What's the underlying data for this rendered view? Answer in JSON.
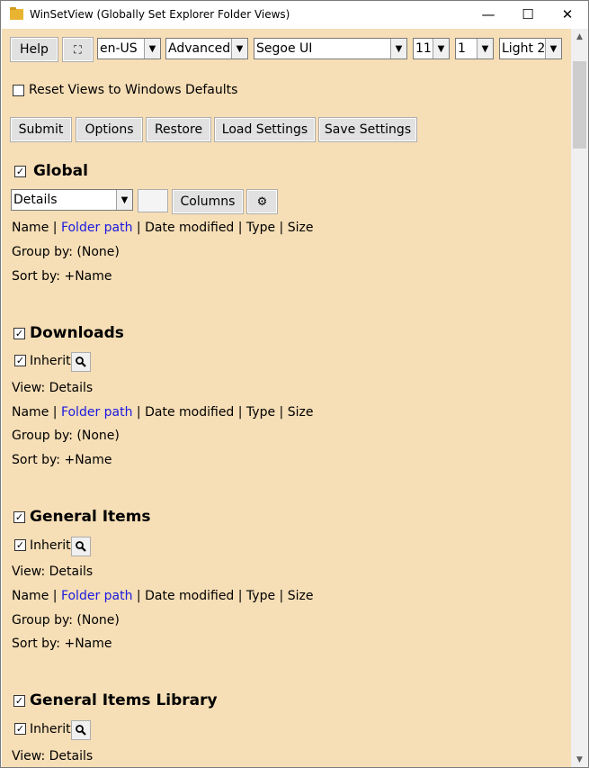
{
  "window": {
    "title": "WinSetView (Globally Set Explorer Folder Views)",
    "min": "—",
    "max": "☐",
    "close": "✕"
  },
  "toolbar": {
    "help": "Help",
    "fullscreen": "⛶",
    "language": "en-US",
    "mode": "Advanced",
    "font": "Segoe UI",
    "font_size": "11",
    "spacing": "1",
    "theme": "Light 2"
  },
  "reset_label": "Reset Views to Windows Defaults",
  "actions": {
    "submit": "Submit",
    "options": "Options",
    "restore": "Restore",
    "load": "Load Settings",
    "save": "Save Settings"
  },
  "global": {
    "title": "Global",
    "view": "Details",
    "columns_button": "Columns",
    "gear": "⚙",
    "columns": {
      "name": "Name",
      "sep": " | ",
      "folder_path": "Folder path",
      "rest": "Date modified | Type | Size"
    },
    "group_by": "Group by: (None)",
    "sort_by": "Sort by: +Name"
  },
  "sections": [
    {
      "title": "Downloads",
      "inherit": "Inherit",
      "view": "View: Details",
      "group_by": "Group by: (None)",
      "sort_by": "Sort by: +Name"
    },
    {
      "title": "General Items",
      "inherit": "Inherit",
      "view": "View: Details",
      "group_by": "Group by: (None)",
      "sort_by": "Sort by: +Name"
    },
    {
      "title": "General Items Library",
      "inherit": "Inherit",
      "view": "View: Details"
    }
  ],
  "checkmark": "✓",
  "dropdown_arrow": "▼"
}
